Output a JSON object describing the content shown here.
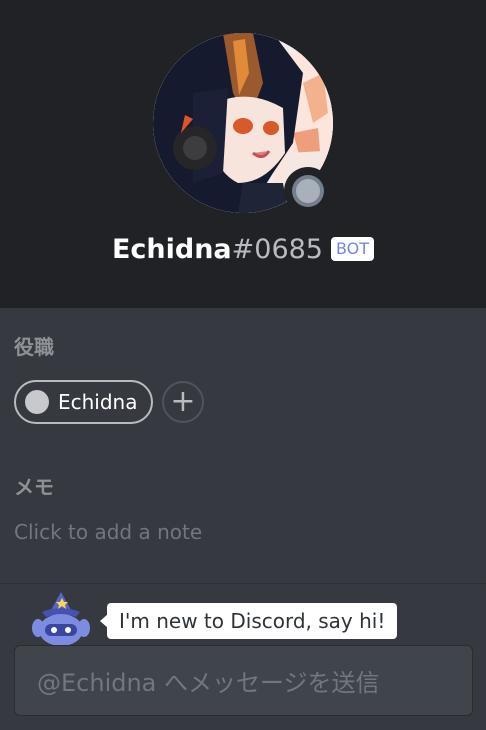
{
  "profile": {
    "username": "Echidna",
    "discriminator": "#0685",
    "bot_tag": "BOT",
    "status_color": "#747f8d"
  },
  "roles": {
    "title": "役職",
    "items": [
      {
        "label": "Echidna",
        "color": "#c7c9cc"
      }
    ],
    "add_symbol": "+"
  },
  "note": {
    "title": "メモ",
    "placeholder": "Click to add a note"
  },
  "greeting": {
    "bubble_text": "I'm new to Discord, say hi!"
  },
  "message": {
    "placeholder": "@Echidna へメッセージを送信"
  },
  "colors": {
    "background": "#36393f",
    "header": "#202225",
    "accent": "#7289da"
  }
}
